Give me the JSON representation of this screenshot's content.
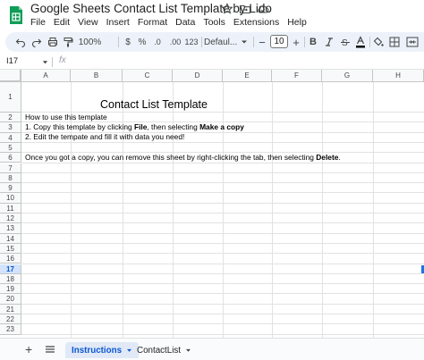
{
  "app": {
    "title": "Google Sheets Contact List Template by Lido",
    "menu": [
      "File",
      "Edit",
      "View",
      "Insert",
      "Format",
      "Data",
      "Tools",
      "Extensions",
      "Help"
    ],
    "title_icons": [
      "star-icon",
      "move-to-folder-icon",
      "cloud-saved-icon"
    ],
    "brand_color": "#0f9d58"
  },
  "toolbar": {
    "zoom": "100%",
    "currency": "$",
    "percent": "%",
    "decrease_decimal": ".0",
    "increase_decimal": ".00",
    "more_formats": "123",
    "font": "Defaul...",
    "font_size": "10",
    "bold": "B",
    "icons": [
      "undo-icon",
      "redo-icon",
      "print-icon",
      "paint-format-icon",
      "italic-icon",
      "strikethrough-icon",
      "text-color-icon",
      "fill-color-icon",
      "borders-icon",
      "merge-icon"
    ]
  },
  "formula_bar": {
    "cell_ref": "I17",
    "fx": "fx",
    "value": ""
  },
  "grid": {
    "columns": [
      "A",
      "B",
      "C",
      "D",
      "E",
      "F",
      "G",
      "H"
    ],
    "rows": [
      "1",
      "2",
      "3",
      "4",
      "5",
      "6",
      "7",
      "8",
      "9",
      "10",
      "11",
      "12",
      "13",
      "14",
      "15",
      "16",
      "17",
      "18",
      "19",
      "20",
      "21",
      "22",
      "23"
    ],
    "selected_row": "17",
    "cells": {
      "title": "Contact List Template",
      "r2": "How to use this template",
      "r3_a": "1. Copy this template by clicking ",
      "r3_b": "File",
      "r3_c": ", then selecting ",
      "r3_d": "Make a copy",
      "r4": "2. Edit the tempate and fill it with data you need!",
      "r6_a": "Once you got a copy, you can remove this sheet by right-clicking the tab, then selecting ",
      "r6_b": "Delete",
      "r6_c": "."
    }
  },
  "sheets": {
    "add": "+",
    "tabs": [
      {
        "label": "Instructions",
        "active": true
      },
      {
        "label": "ContactList",
        "active": false
      }
    ]
  }
}
